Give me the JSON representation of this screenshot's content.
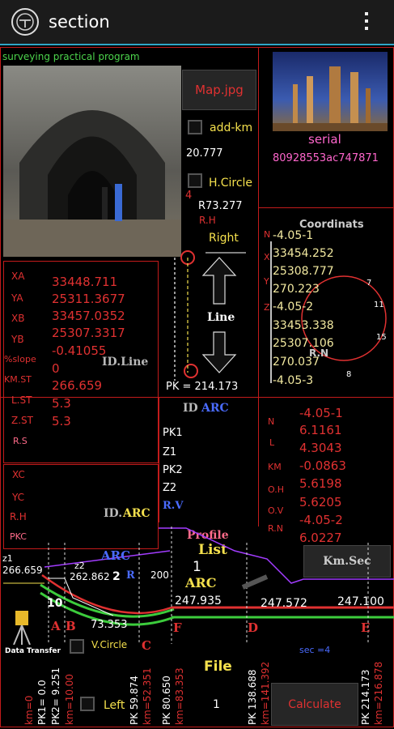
{
  "app": {
    "title": "section"
  },
  "banner": "surveying practical program",
  "map_button": "Map.jpg",
  "add_km": "add-km",
  "value_20777": "20.777",
  "h_circle": "H.Circle",
  "r_value": "R73.277",
  "rh_label": "R.H",
  "right_label": "Right",
  "serial": {
    "label": "serial",
    "value": "80928553ac747871"
  },
  "coordinats": {
    "title": "Coordinats",
    "letters": [
      "N",
      "X",
      "Y",
      "Z"
    ],
    "values": [
      "-4.05-1",
      "33454.252",
      "25308.777",
      "270.223",
      "-4.05-2",
      "33453.338",
      "25307.106",
      "270.037",
      "-4.05-3"
    ],
    "circle_numbers": [
      "7",
      "11",
      "15",
      "8"
    ],
    "rn": "R.N"
  },
  "line_panel": {
    "labels": [
      "XA",
      "YA",
      "XB",
      "YB",
      "%slope",
      "KM.ST",
      "L.ST",
      "Z.ST"
    ],
    "values": [
      "33448.711",
      "25311.3677",
      "33457.0352",
      "25307.3317",
      "-0.41055",
      "0",
      "266.659",
      "5.3"
    ],
    "rs": "R.S",
    "id_line": "ID.Line"
  },
  "line_diagram": {
    "line": "Line",
    "pk": "PK = 214.173",
    "marker4": "4"
  },
  "id_arc_top": {
    "id": "ID",
    "arc": "ARC"
  },
  "pk_list": [
    "PK1",
    "Z1",
    "PK2",
    "Z2"
  ],
  "rv": "R.V",
  "arc_panel": {
    "labels": [
      "XC",
      "YC",
      "R.H",
      "PKC"
    ],
    "id": "ID.",
    "arc": "ARC"
  },
  "result_panel": {
    "labels": [
      "N",
      "L",
      "KM",
      "O.H",
      "O.V",
      "R.N"
    ],
    "values": [
      "-4.05-1",
      "6.1161",
      "4.3043",
      "-0.0863",
      "5.6198",
      "5.6205",
      "-4.05-2",
      "6.0227"
    ]
  },
  "profile": {
    "title": "Profile",
    "list": "List",
    "arc": "ARC",
    "one": "1"
  },
  "km_sec": "Km.Sec",
  "profile_graph": {
    "z1": "z1",
    "z1_value": "266.659",
    "z2": "z2",
    "z2_value": "262.862",
    "arc": "ARC",
    "r": "R",
    "v200": "200",
    "two": "2",
    "ten": "10",
    "r_value": "73.353",
    "elevations": [
      "247.935",
      "247.572",
      "247.100"
    ],
    "points": [
      "A",
      "B",
      "C",
      "F",
      "D",
      "E"
    ]
  },
  "data_transfer": "Data Transfer",
  "v_circle": "V.Circle",
  "left_label": "Left",
  "file_label": "File",
  "file_count": "1",
  "sec_label": "sec =4",
  "calculate": "Calculate",
  "km_axis": [
    "km=0",
    "PK1= 0.0",
    "PK2= 9.251",
    "km=10.00",
    "PK 59.874",
    "km=52.351",
    "PK 80.650",
    "km=83.353",
    "PK 138.688",
    "km=141.392",
    "PK 214.173",
    "km=216.878"
  ]
}
